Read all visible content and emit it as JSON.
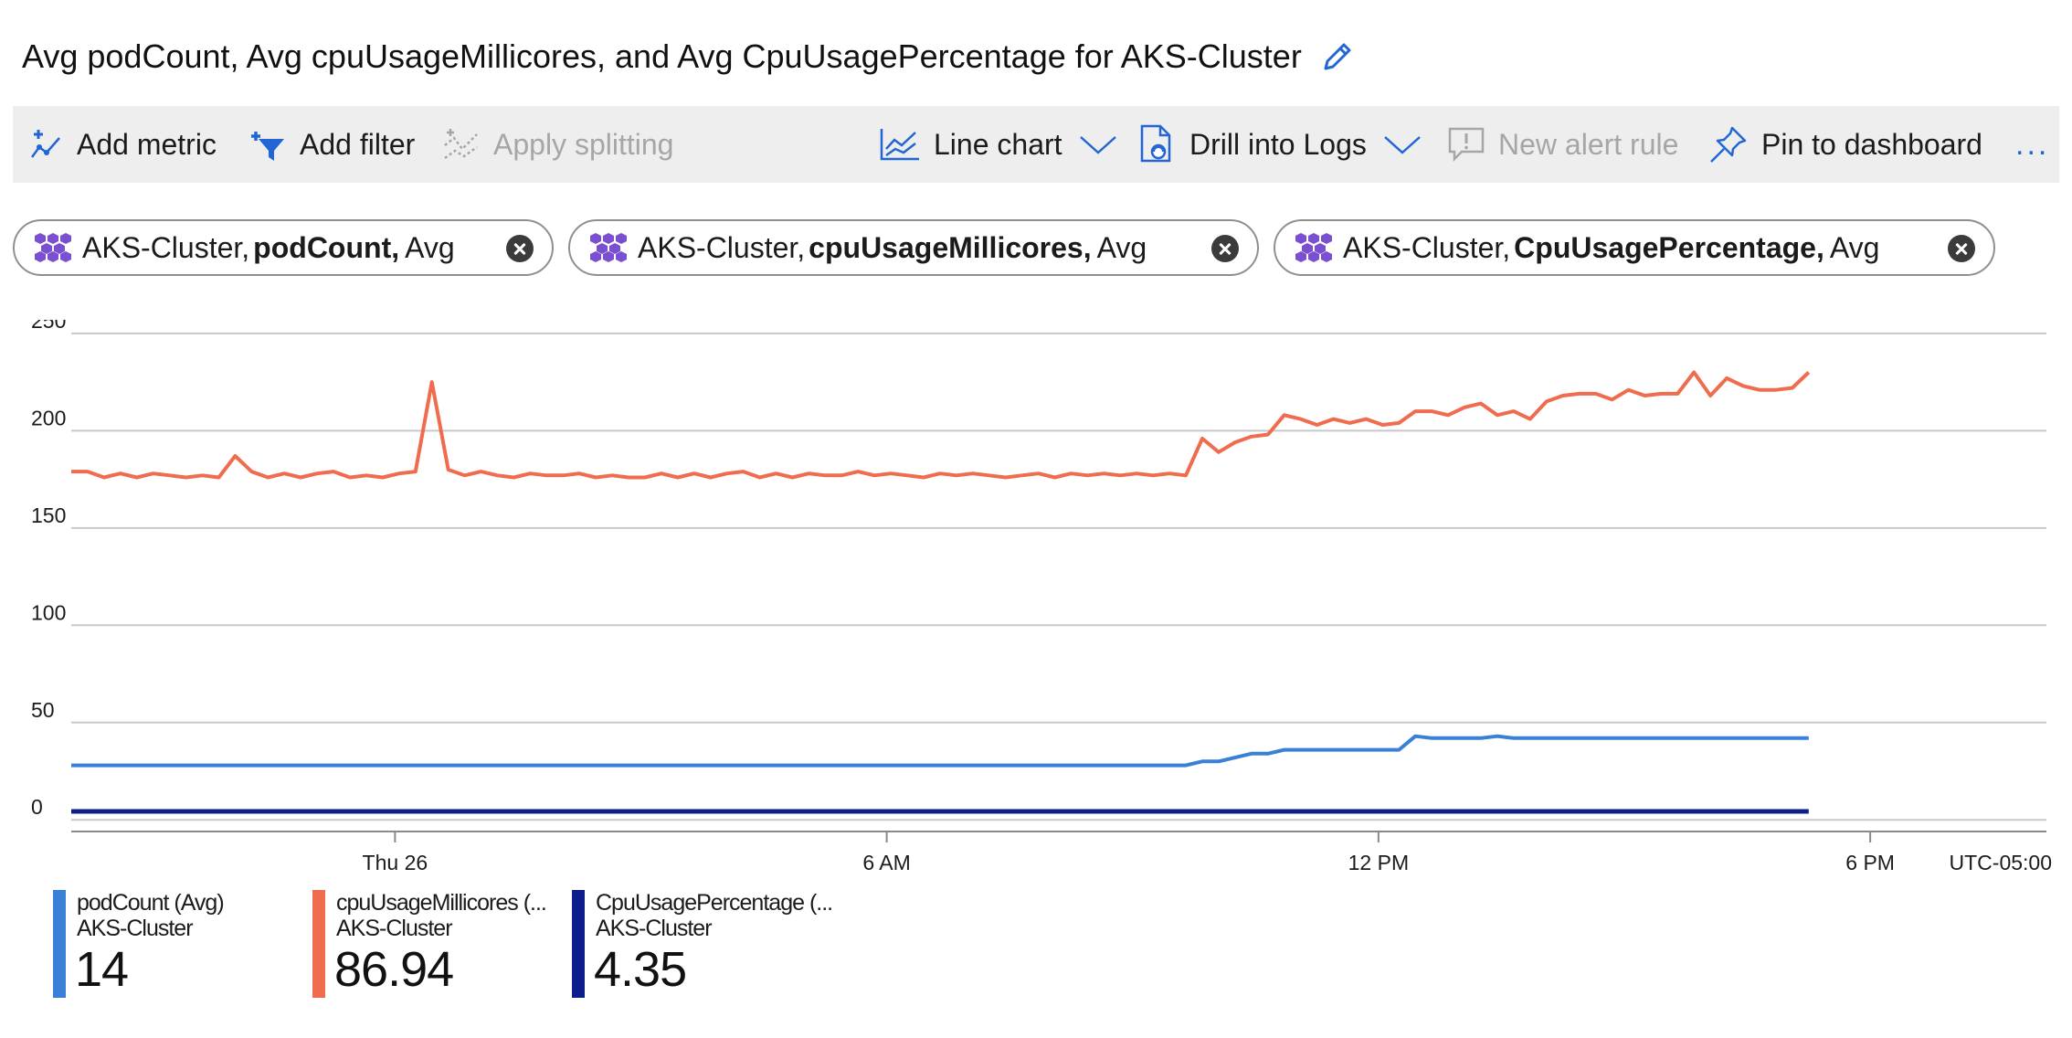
{
  "title": "Avg podCount, Avg cpuUsageMillicores, and Avg CpuUsagePercentage for AKS-Cluster",
  "toolbar": {
    "add_metric": "Add metric",
    "add_filter": "Add filter",
    "apply_splitting": "Apply splitting",
    "line_chart": "Line chart",
    "drill_into_logs": "Drill into Logs",
    "new_alert_rule": "New alert rule",
    "pin_to_dashboard": "Pin to dashboard",
    "more": "..."
  },
  "pills": [
    {
      "resource": "AKS-Cluster,",
      "metric": "podCount,",
      "agg": "Avg"
    },
    {
      "resource": "AKS-Cluster,",
      "metric": "cpuUsageMillicores,",
      "agg": "Avg"
    },
    {
      "resource": "AKS-Cluster,",
      "metric": "CpuUsagePercentage,",
      "agg": "Avg"
    }
  ],
  "colors": {
    "podCount": "#3a7fd8",
    "cpuUsageMillicores": "#ef6c4e",
    "CpuUsagePercentage": "#0c1e8c",
    "accent": "#2266d6",
    "resource_icon": "#7a4fd0"
  },
  "chart_data": {
    "type": "line",
    "x_tick_labels": [
      "Thu 26",
      "6 AM",
      "12 PM",
      "6 PM"
    ],
    "timezone": "UTC-05:00",
    "y_ticks": [
      0,
      50,
      100,
      150,
      200,
      250
    ],
    "ylim": [
      -6,
      257
    ],
    "x_hours": [
      -3.95,
      20.15
    ],
    "grid": true,
    "legend_position": "bottom-left",
    "series": [
      {
        "name": "cpuUsageMillicores (...",
        "key": "cpuUsageMillicores",
        "points": [
          [
            -3.95,
            179
          ],
          [
            -3.75,
            179
          ],
          [
            -3.55,
            176
          ],
          [
            -3.35,
            178
          ],
          [
            -3.15,
            176
          ],
          [
            -2.95,
            178
          ],
          [
            -2.75,
            177
          ],
          [
            -2.55,
            176
          ],
          [
            -2.35,
            177
          ],
          [
            -2.15,
            176
          ],
          [
            -1.95,
            187
          ],
          [
            -1.75,
            179
          ],
          [
            -1.55,
            176
          ],
          [
            -1.35,
            178
          ],
          [
            -1.15,
            176
          ],
          [
            -0.95,
            178
          ],
          [
            -0.75,
            179
          ],
          [
            -0.55,
            176
          ],
          [
            -0.35,
            177
          ],
          [
            -0.15,
            176
          ],
          [
            0.05,
            178
          ],
          [
            0.25,
            179
          ],
          [
            0.45,
            225
          ],
          [
            0.65,
            180
          ],
          [
            0.85,
            177
          ],
          [
            1.05,
            179
          ],
          [
            1.25,
            177
          ],
          [
            1.45,
            176
          ],
          [
            1.65,
            178
          ],
          [
            1.85,
            177
          ],
          [
            2.05,
            177
          ],
          [
            2.25,
            178
          ],
          [
            2.45,
            176
          ],
          [
            2.65,
            177
          ],
          [
            2.85,
            176
          ],
          [
            3.05,
            176
          ],
          [
            3.25,
            178
          ],
          [
            3.45,
            176
          ],
          [
            3.65,
            178
          ],
          [
            3.85,
            176
          ],
          [
            4.05,
            178
          ],
          [
            4.25,
            179
          ],
          [
            4.45,
            176
          ],
          [
            4.65,
            178
          ],
          [
            4.85,
            176
          ],
          [
            5.05,
            178
          ],
          [
            5.25,
            177
          ],
          [
            5.45,
            177
          ],
          [
            5.65,
            179
          ],
          [
            5.85,
            177
          ],
          [
            6.05,
            178
          ],
          [
            6.25,
            177
          ],
          [
            6.45,
            176
          ],
          [
            6.65,
            178
          ],
          [
            6.85,
            177
          ],
          [
            7.05,
            178
          ],
          [
            7.25,
            177
          ],
          [
            7.45,
            176
          ],
          [
            7.65,
            177
          ],
          [
            7.85,
            178
          ],
          [
            8.05,
            176
          ],
          [
            8.25,
            178
          ],
          [
            8.45,
            177
          ],
          [
            8.65,
            178
          ],
          [
            8.85,
            177
          ],
          [
            9.05,
            178
          ],
          [
            9.25,
            177
          ],
          [
            9.45,
            178
          ],
          [
            9.65,
            177
          ],
          [
            9.85,
            196
          ],
          [
            10.05,
            189
          ],
          [
            10.25,
            194
          ],
          [
            10.45,
            197
          ],
          [
            10.65,
            198
          ],
          [
            10.85,
            208
          ],
          [
            11.05,
            206
          ],
          [
            11.25,
            203
          ],
          [
            11.45,
            206
          ],
          [
            11.65,
            204
          ],
          [
            11.85,
            206
          ],
          [
            12.05,
            203
          ],
          [
            12.25,
            204
          ],
          [
            12.45,
            210
          ],
          [
            12.65,
            210
          ],
          [
            12.85,
            208
          ],
          [
            13.05,
            212
          ],
          [
            13.25,
            214
          ],
          [
            13.45,
            208
          ],
          [
            13.65,
            210
          ],
          [
            13.85,
            206
          ],
          [
            14.05,
            215
          ],
          [
            14.25,
            218
          ],
          [
            14.45,
            219
          ],
          [
            14.65,
            219
          ],
          [
            14.85,
            216
          ],
          [
            15.05,
            221
          ],
          [
            15.25,
            218
          ],
          [
            15.45,
            219
          ],
          [
            15.65,
            219
          ],
          [
            15.85,
            230
          ],
          [
            16.05,
            218
          ],
          [
            16.25,
            227
          ],
          [
            16.45,
            223
          ],
          [
            16.65,
            221
          ],
          [
            16.85,
            221
          ],
          [
            17.05,
            222
          ],
          [
            17.25,
            230
          ]
        ]
      },
      {
        "name": "podCount (Avg)",
        "key": "podCount",
        "points": [
          [
            -3.95,
            28
          ],
          [
            9.35,
            28
          ],
          [
            9.65,
            28
          ],
          [
            9.85,
            30
          ],
          [
            10.05,
            30
          ],
          [
            10.25,
            32
          ],
          [
            10.45,
            34
          ],
          [
            10.65,
            34
          ],
          [
            10.85,
            36
          ],
          [
            12.25,
            36
          ],
          [
            12.45,
            43
          ],
          [
            12.65,
            42
          ],
          [
            13.25,
            42
          ],
          [
            13.45,
            43
          ],
          [
            13.65,
            42
          ],
          [
            17.25,
            42
          ]
        ]
      },
      {
        "name": "CpuUsagePercentage (...",
        "key": "CpuUsagePercentage",
        "points": [
          [
            -3.95,
            4.35
          ],
          [
            17.25,
            4.35
          ]
        ]
      }
    ]
  },
  "legend": [
    {
      "name": "podCount (Avg)",
      "resource": "AKS-Cluster",
      "value": "14"
    },
    {
      "name": "cpuUsageMillicores (...",
      "resource": "AKS-Cluster",
      "value": "86.94"
    },
    {
      "name": "CpuUsagePercentage (...",
      "resource": "AKS-Cluster",
      "value": "4.35"
    }
  ]
}
